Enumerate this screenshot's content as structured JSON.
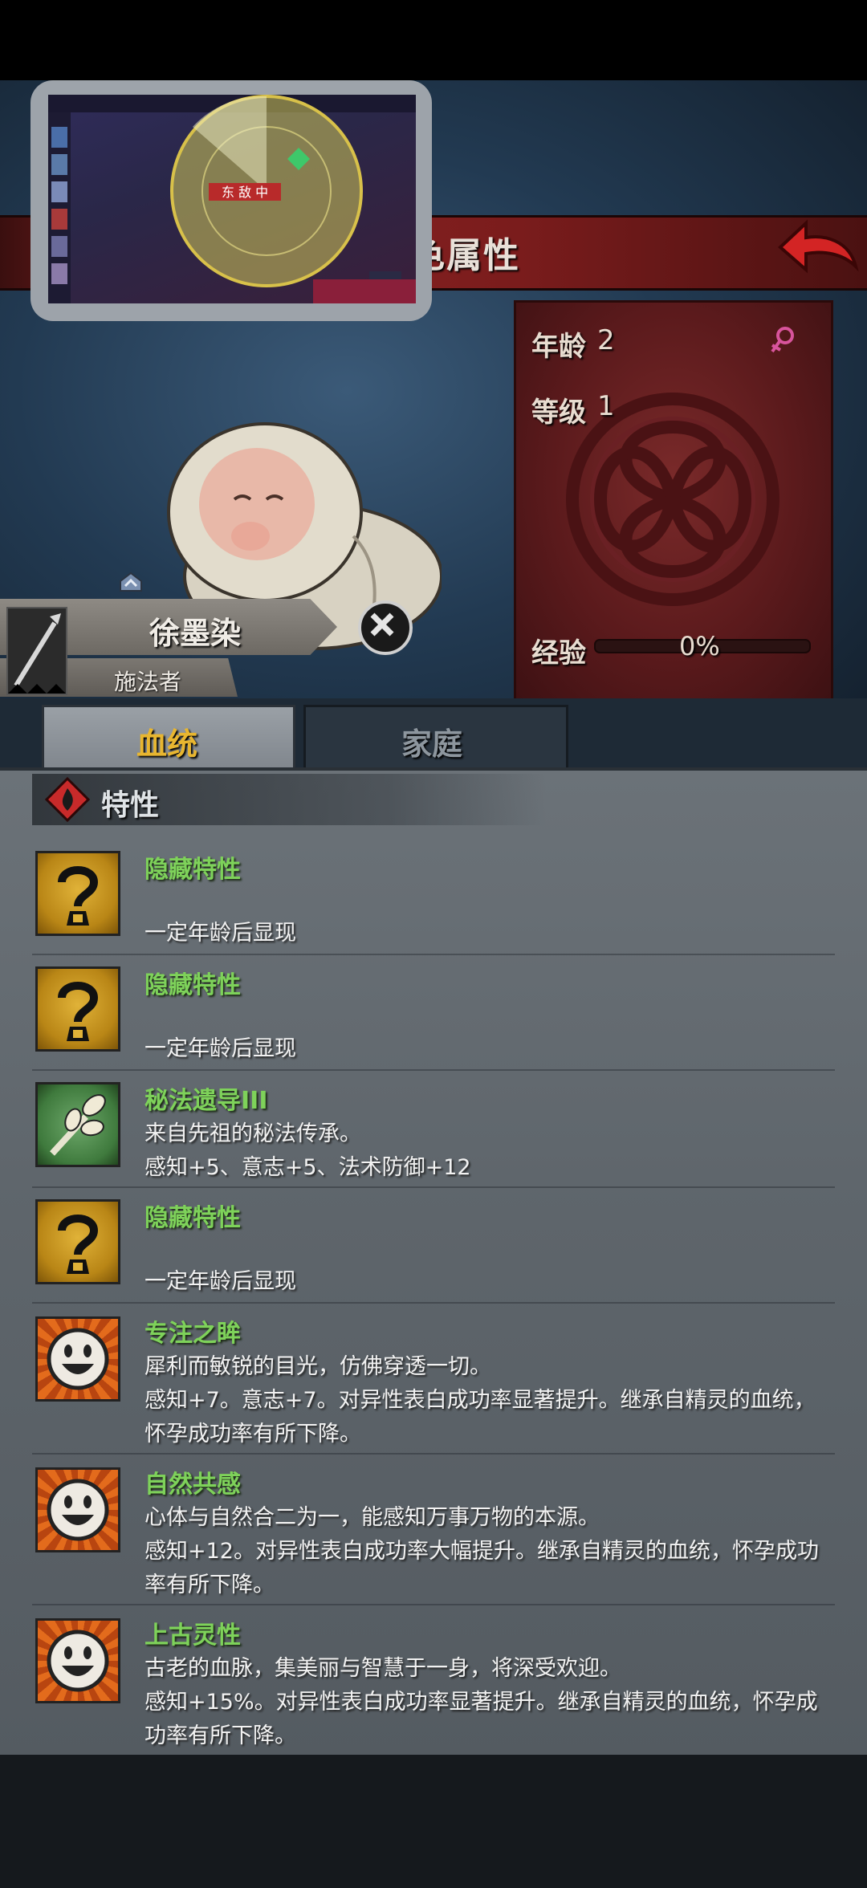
{
  "header": {
    "title": "色属性"
  },
  "character": {
    "name": "徐墨染",
    "class": "施法者",
    "age_label": "年龄",
    "age_value": "2",
    "level_label": "等级",
    "level_value": "1",
    "exp_label": "经验",
    "exp_value": "0%"
  },
  "tabs": [
    {
      "label": "血统",
      "active": true
    },
    {
      "label": "家庭",
      "active": false
    }
  ],
  "section": {
    "title": "特性"
  },
  "traits": [
    {
      "icon": "question-icon",
      "title": "隐藏特性",
      "lines": [
        "",
        "一定年龄后显现"
      ]
    },
    {
      "icon": "question-icon",
      "title": "隐藏特性",
      "lines": [
        "",
        "一定年龄后显现"
      ]
    },
    {
      "icon": "leaf-branch-icon",
      "title": "秘法遗导III",
      "lines": [
        "来自先祖的秘法传承。",
        "感知+5、意志+5、法术防御+12"
      ]
    },
    {
      "icon": "question-icon",
      "title": "隐藏特性",
      "lines": [
        "",
        "一定年龄后显现"
      ]
    },
    {
      "icon": "smiley-icon",
      "title": "专注之眸",
      "lines": [
        "犀利而敏锐的目光，仿佛穿透一切。",
        "感知+7。意志+7。对异性表白成功率显著提升。继承自精灵的血统，",
        "怀孕成功率有所下降。"
      ]
    },
    {
      "icon": "smiley-icon",
      "title": "自然共感",
      "lines": [
        "心体与自然合二为一，能感知万事万物的本源。",
        "感知+12。对异性表白成功率大幅提升。继承自精灵的血统，怀孕成功",
        "率有所下降。"
      ]
    },
    {
      "icon": "smiley-icon",
      "title": "上古灵性",
      "lines": [
        "古老的血脉，集美丽与智慧于一身，将深受欢迎。",
        "感知+15%。对异性表白成功率显著提升。继承自精灵的血统，怀孕成",
        "功率有所下降。"
      ]
    }
  ],
  "thumbnail": {
    "banner_text": "东 敌 中"
  },
  "colors": {
    "trait_title": "#7ed25a",
    "title_bar": "#8d2323",
    "info_panel": "#5b1a1c",
    "female_icon": "#d8549c"
  }
}
